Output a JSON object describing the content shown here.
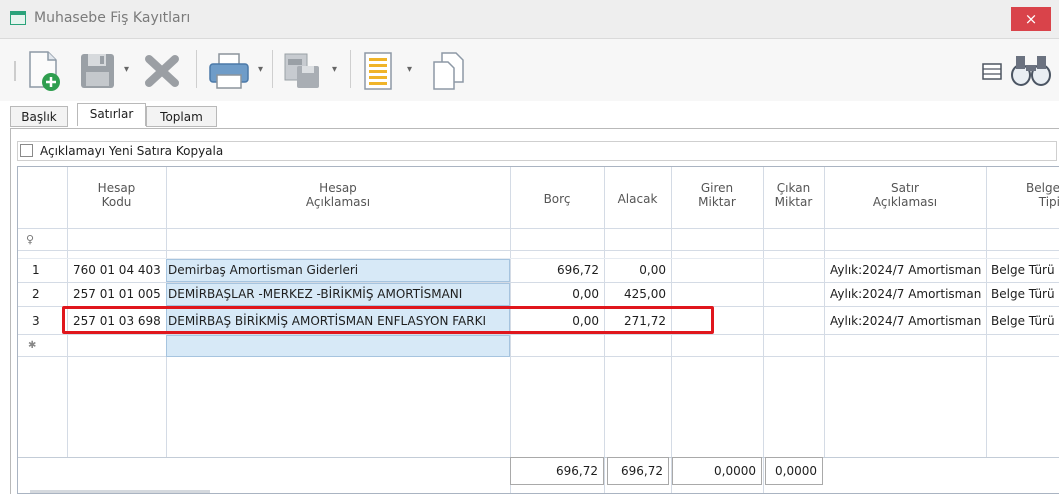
{
  "window": {
    "title": "Muhasebe Fiş Kayıtları",
    "close_glyph": "×"
  },
  "toolbar": {
    "icons": [
      "new-document-icon",
      "save-icon",
      "delete-icon",
      "print-icon",
      "export-text-icon",
      "form-list-icon",
      "copy-document-icon",
      "layout-icon",
      "search-binoculars-icon"
    ],
    "dropdown_glyph": "▾"
  },
  "tabs": [
    {
      "label": "Başlık"
    },
    {
      "label": "Satırlar"
    },
    {
      "label": "Toplam"
    }
  ],
  "options": {
    "copy_description_label": "Açıklamayı Yeni Satıra Kopyala"
  },
  "grid": {
    "columns": [
      {
        "line1": "",
        "line2": ""
      },
      {
        "line1": "Hesap",
        "line2": "Kodu"
      },
      {
        "line1": "Hesap",
        "line2": "Açıklaması"
      },
      {
        "line1": "",
        "line2": "Borç"
      },
      {
        "line1": "",
        "line2": "Alacak"
      },
      {
        "line1": "Giren",
        "line2": "Miktar"
      },
      {
        "line1": "Çıkan",
        "line2": "Miktar"
      },
      {
        "line1": "Satır",
        "line2": "Açıklaması"
      },
      {
        "line1": "Belge",
        "line2": "Tipi"
      }
    ],
    "filter_glyph": "♀",
    "new_row_glyph": "✱",
    "rows": [
      {
        "no": "1",
        "code": "760 01 04 403",
        "desc": "Demirbaş Amortisman Giderleri",
        "debit": "696,72",
        "credit": "0,00",
        "in_qty": "",
        "out_qty": "",
        "line_desc": "Aylık:2024/7 Amortisman",
        "doc_type": "Belge Türü"
      },
      {
        "no": "2",
        "code": "257 01 01 005",
        "desc": "DEMİRBAŞLAR -MERKEZ -BİRİKMİŞ AMORTİSMANI",
        "debit": "0,00",
        "credit": "425,00",
        "in_qty": "",
        "out_qty": "",
        "line_desc": "Aylık:2024/7 Amortisman",
        "doc_type": "Belge Türü"
      },
      {
        "no": "3",
        "code": "257 01 03 698",
        "desc": "DEMİRBAŞ BİRİKMİŞ AMORTİSMAN ENFLASYON FARKI",
        "debit": "0,00",
        "credit": "271,72",
        "in_qty": "",
        "out_qty": "",
        "line_desc": "Aylık:2024/7 Amortisman",
        "doc_type": "Belge Türü"
      }
    ],
    "totals": {
      "debit": "696,72",
      "credit": "696,72",
      "in_qty": "0,0000",
      "out_qty": "0,0000"
    }
  },
  "colors": {
    "highlight_border": "#e0161c",
    "close_bg": "#d9434a",
    "selected_cell": "#d7e9f7"
  }
}
